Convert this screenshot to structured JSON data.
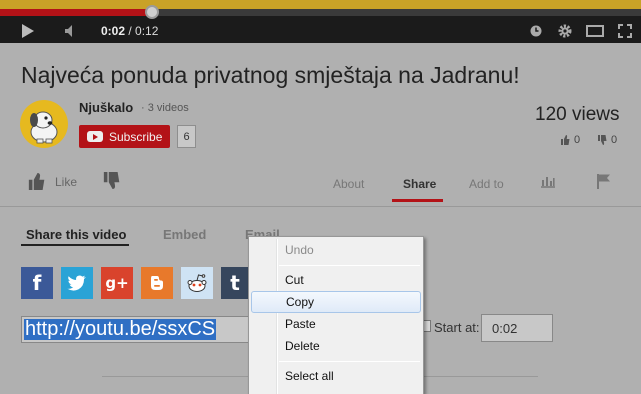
{
  "player": {
    "current_time": "0:02",
    "separator": " / ",
    "duration": "0:12",
    "progress": 0.17,
    "colors": {
      "played": "#b31217",
      "chrome": "#1b1b1b"
    }
  },
  "video": {
    "title": "Najveća ponuda privatnog smještaja na Jadranu!",
    "views": "120 views",
    "likes": "0",
    "dislikes": "0"
  },
  "channel": {
    "name": "Njuškalo",
    "video_count": "· 3 videos",
    "subscribe_label": "Subscribe",
    "subscriber_count": "6"
  },
  "actions": {
    "like_label": "Like",
    "tabs": [
      "About",
      "Share",
      "Add to"
    ],
    "active_tab": "Share"
  },
  "share": {
    "subtabs": [
      "Share this video",
      "Embed",
      "Email"
    ],
    "active_subtab": "Share this video",
    "networks": [
      "facebook-icon",
      "twitter-icon",
      "google-plus-icon",
      "blogger-icon",
      "reddit-icon",
      "tumblr-icon"
    ],
    "url": "http://youtu.be/ssxCS",
    "start_at_label": "Start at:",
    "start_at_value": "0:02"
  },
  "context_menu": {
    "items": [
      "Undo",
      "Cut",
      "Copy",
      "Paste",
      "Delete",
      "Select all"
    ],
    "highlighted": "Copy",
    "disabled": [
      "Undo"
    ]
  }
}
